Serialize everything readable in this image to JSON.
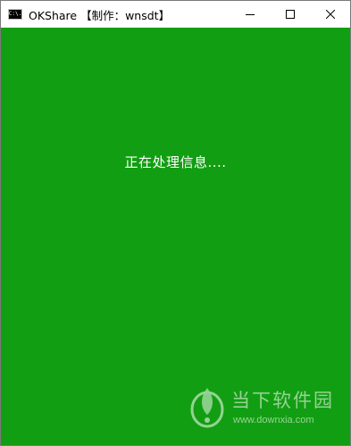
{
  "window": {
    "title": "OKShare 【制作：wnsdt】",
    "icon": "console-icon",
    "icon_label": "C:\\."
  },
  "controls": {
    "minimize_icon": "minimize-icon",
    "maximize_icon": "maximize-icon",
    "close_icon": "close-icon"
  },
  "content": {
    "status_text": "正在处理信息....",
    "background_color": "#129e12",
    "text_color": "#ffffff"
  },
  "watermark": {
    "name": "当下软件园",
    "url": "www.downxia.com"
  }
}
